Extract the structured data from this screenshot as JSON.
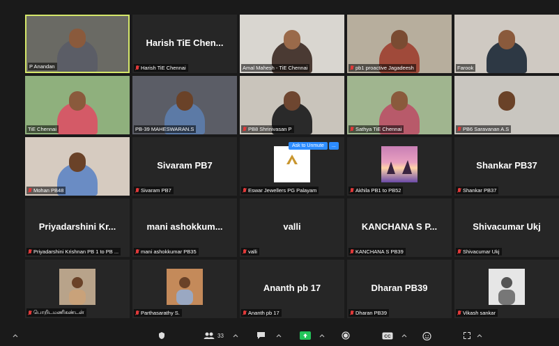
{
  "participants": [
    {
      "name": "P Anandan",
      "label": "P Anandan",
      "muted": false,
      "video": true,
      "bg": "#6a6a64",
      "shirt": "#5b5d66",
      "skin": "#8a5a3c"
    },
    {
      "name": "Harish TiE Chen...",
      "label": "Harish TiE Chennai",
      "muted": true,
      "video": false
    },
    {
      "name": "Amal Mahesh",
      "label": "Amal Mahesh - TiE Chennai",
      "muted": false,
      "video": true,
      "bg": "#d9d6d0",
      "shirt": "#4a3a33",
      "skin": "#9a6a4a"
    },
    {
      "name": "pb1 proactive Jagadeesh",
      "label": "pb1 proactive Jagadeesh",
      "muted": true,
      "video": true,
      "bg": "#b7ae9d",
      "shirt": "#a04a3a",
      "skin": "#7a4b32"
    },
    {
      "name": "Farook",
      "label": "Farook",
      "muted": false,
      "video": true,
      "bg": "#cfc9c2",
      "shirt": "#2d3844",
      "skin": "#8a5a3c"
    },
    {
      "name": "TiE Chennai",
      "label": "TiE Chennai",
      "muted": false,
      "video": true,
      "bg": "#8fb07d",
      "shirt": "#d45a67",
      "skin": "#8a5a3c"
    },
    {
      "name": "PB-39 MAHESWARAN.S",
      "label": "PB-39 MAHESWARAN.S",
      "muted": false,
      "video": true,
      "bg": "#5b5d66",
      "shirt": "#5c7aa6",
      "skin": "#6a4228"
    },
    {
      "name": "PB8 Shrinivasan P",
      "label": "PB8 Shrinivasan P",
      "muted": true,
      "video": true,
      "bg": "#c9c4bb",
      "shirt": "#2a2a2a",
      "skin": "#6e4630"
    },
    {
      "name": "Sathya TiE Chennai",
      "label": "Sathya TiE Chennai",
      "muted": true,
      "video": true,
      "bg": "#a0b58f",
      "shirt": "#b85a6a",
      "skin": "#8a5a3c"
    },
    {
      "name": "PB6 Saravanan A.S",
      "label": "PB6 Saravanan A.S",
      "muted": true,
      "video": true,
      "bg": "#c9c6c0",
      "shirt": "#c9c6c0",
      "skin": "#6a4228"
    },
    {
      "name": "Mohan PB48",
      "label": "Mohan PB48",
      "muted": true,
      "video": true,
      "bg": "#d6cbc0",
      "shirt": "#6a8cc4",
      "skin": "#6a4228"
    },
    {
      "name": "Sivaram PB7",
      "label": "Sivaram PB7",
      "muted": true,
      "video": false
    },
    {
      "name": "Eswar Jewellers PG Palayam",
      "label": "Eswar Jewellers PG Palayam",
      "muted": true,
      "video": false,
      "thumb": "eswar"
    },
    {
      "name": "Akhila PB1 to PB52",
      "label": "Akhila PB1 to PB52",
      "muted": true,
      "video": false,
      "thumb": "sunset"
    },
    {
      "name": "Shankar PB37",
      "label": "Shankar PB37",
      "muted": true,
      "video": false
    },
    {
      "name": "Priyadarshini Kr...",
      "label": "Priyadarshini Krishnan PB 1 to PB ...",
      "muted": true,
      "video": false
    },
    {
      "name": "mani ashokkum...",
      "label": "mani ashokkumar PB35",
      "muted": true,
      "video": false
    },
    {
      "name": "valli",
      "label": "valli",
      "muted": true,
      "video": false
    },
    {
      "name": "KANCHANA S P...",
      "label": "KANCHANA S PB39",
      "muted": true,
      "video": false
    },
    {
      "name": "Shivacumar Ukj",
      "label": "Shivacumar Ukj",
      "muted": true,
      "video": false
    },
    {
      "name": "பொறிடமணிகண்டன்",
      "label": "பொறிடமணிகண்டன்",
      "muted": true,
      "video": false,
      "thumb": "photo1"
    },
    {
      "name": "Parthasarathy S.",
      "label": "Parthasarathy S.",
      "muted": true,
      "video": false,
      "thumb": "photo2"
    },
    {
      "name": "Ananth pb 17",
      "label": "Ananth pb 17",
      "muted": true,
      "video": false
    },
    {
      "name": "Dharan PB39",
      "label": "Dharan PB39",
      "muted": true,
      "video": false
    },
    {
      "name": "Vikash sankar",
      "label": "Vikash sankar",
      "muted": true,
      "video": false,
      "thumb": "photo3"
    }
  ],
  "overlay": {
    "unmute_label": "Ask to Unmute",
    "more_label": "..."
  },
  "toolbar": {
    "participants_count": "33"
  }
}
